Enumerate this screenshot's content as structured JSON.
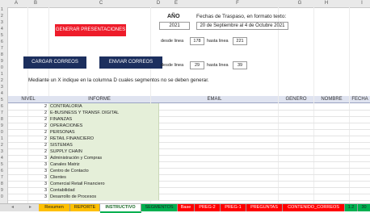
{
  "column_headers": [
    "A",
    "B",
    "C",
    "D",
    "E",
    "F",
    "G",
    "H",
    "I"
  ],
  "row_numbers": [
    "1",
    "2",
    "3",
    "4",
    "5",
    "6",
    "7",
    "8",
    "9",
    "0",
    "1",
    "2",
    "3",
    "4",
    "5",
    "6",
    "7",
    "8",
    "9",
    "0",
    "1",
    "2",
    "3",
    "4",
    "5",
    "6",
    "7",
    "8",
    "9",
    "0"
  ],
  "anio": {
    "label": "AÑO",
    "value": "2021"
  },
  "fechas": {
    "label": "Fechas de Traspaso, en formato texto:",
    "value": "20 de Septiembre al 4 de Octubre 2021"
  },
  "buttons": {
    "generar": "GENERAR PRESENTACIONES",
    "cargar": "CARGAR CORREOS",
    "enviar": "ENVIAR CORREOS"
  },
  "range1": {
    "desde_label": "desde linea",
    "desde": "178",
    "hasta_label": "hasta linea",
    "hasta": "221"
  },
  "range2": {
    "desde_label": "desde linea",
    "desde": "29",
    "hasta_label": "hasta linea",
    "hasta": "39"
  },
  "instruction": "Mediante un X indique en la columna D cuales segmentos no se deben generar.",
  "table": {
    "headers": [
      "NIVEL",
      "INFORME",
      "EMAIL",
      "GENERO",
      "NOMBRE",
      "FECHA"
    ],
    "rows": [
      {
        "nivel": "2",
        "informe": "CONTRALORIA"
      },
      {
        "nivel": "2",
        "informe": "E-BUSINESS Y TRANSF. DIGITAL"
      },
      {
        "nivel": "2",
        "informe": "FINANZAS"
      },
      {
        "nivel": "2",
        "informe": "OPERACIONES"
      },
      {
        "nivel": "2",
        "informe": "PERSONAS"
      },
      {
        "nivel": "2",
        "informe": "RETAIL FINANCIERO"
      },
      {
        "nivel": "2",
        "informe": "SISTEMAS"
      },
      {
        "nivel": "2",
        "informe": "SUPPLY CHAIN"
      },
      {
        "nivel": "3",
        "informe": "Administración y Compras"
      },
      {
        "nivel": "3",
        "informe": "Canales Matriz"
      },
      {
        "nivel": "3",
        "informe": "Centro de Contacto"
      },
      {
        "nivel": "3",
        "informe": "Clientes"
      },
      {
        "nivel": "3",
        "informe": "Comercial Retail Financiero"
      },
      {
        "nivel": "3",
        "informe": "Contabilidad"
      },
      {
        "nivel": "3",
        "informe": "Desarrollo de Procesos"
      }
    ]
  },
  "sheet_tabs": [
    {
      "label": "Resumen",
      "color": "#ffc000"
    },
    {
      "label": "REPORTE",
      "color": "#ffc000"
    },
    {
      "label": "INSTRUCTIVO",
      "color": "#ffffff"
    },
    {
      "label": "SEGMENTOS",
      "color": "#00b050"
    },
    {
      "label": "Base",
      "color": "#ff0000"
    },
    {
      "label": "PREG-2",
      "color": "#ff0000"
    },
    {
      "label": "PREG-1",
      "color": "#ff0000"
    },
    {
      "label": "PREGUNTAS",
      "color": "#ff0000"
    },
    {
      "label": "CONTENIDO_CORREOS",
      "color": "#ff0000"
    },
    {
      "label": "1.2",
      "color": "#00b050"
    },
    {
      "label": "30",
      "color": "#00b050"
    }
  ],
  "colors": {
    "red_button": "#ee1c2a",
    "navy_button": "#1c2f5e",
    "informe_fill": "#e5efd9",
    "active_tab": "#ffffff"
  }
}
